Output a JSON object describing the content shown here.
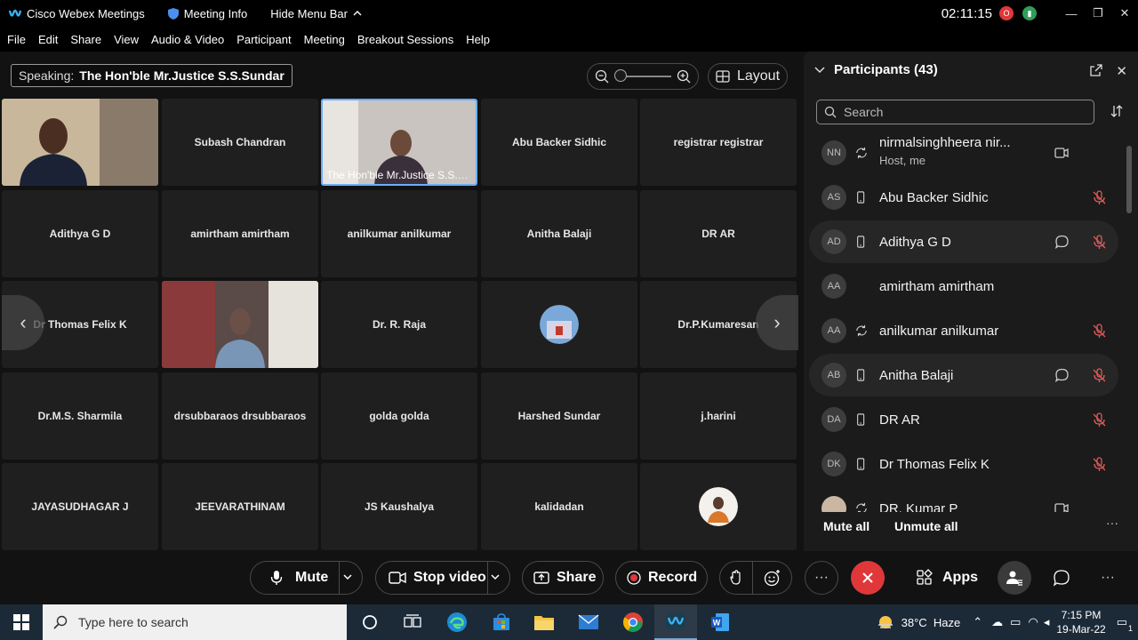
{
  "titlebar": {
    "app_name": "Cisco Webex Meetings",
    "meeting_info": "Meeting Info",
    "hide_menu_bar": "Hide Menu Bar",
    "elapsed_time": "02:11:15",
    "user_badge": "O"
  },
  "menu": [
    "File",
    "Edit",
    "Share",
    "View",
    "Audio & Video",
    "Participant",
    "Meeting",
    "Breakout Sessions",
    "Help"
  ],
  "speaking": {
    "label": "Speaking:",
    "name": "The Hon'ble Mr.Justice S.S.Sundar"
  },
  "layout_button": "Layout",
  "video_grid": {
    "tiles": [
      {
        "name": "",
        "video": true
      },
      {
        "name": "Subash Chandran"
      },
      {
        "name": "The Hon'ble Mr.Justice S.S.Sundar",
        "video": true,
        "active": true
      },
      {
        "name": "Abu Backer Sidhic"
      },
      {
        "name": "registrar registrar"
      },
      {
        "name": "Adithya G D"
      },
      {
        "name": "amirtham amirtham"
      },
      {
        "name": "anilkumar anilkumar"
      },
      {
        "name": "Anitha Balaji"
      },
      {
        "name": "DR AR"
      },
      {
        "name": "Dr Thomas Felix K"
      },
      {
        "name": "",
        "video": true
      },
      {
        "name": "Dr. R. Raja"
      },
      {
        "name": "",
        "avatar": true
      },
      {
        "name": "Dr.P.Kumaresan"
      },
      {
        "name": "Dr.M.S. Sharmila"
      },
      {
        "name": "drsubbaraos drsubbaraos"
      },
      {
        "name": "golda golda"
      },
      {
        "name": "Harshed Sundar"
      },
      {
        "name": "j.harini"
      },
      {
        "name": "JAYASUDHAGAR J"
      },
      {
        "name": "JEEVARATHINAM"
      },
      {
        "name": "JS Kaushalya"
      },
      {
        "name": "kalidadan"
      },
      {
        "name": "",
        "avatar": true
      }
    ]
  },
  "participants_panel": {
    "title": "Participants (43)",
    "search_placeholder": "Search",
    "mute_all": "Mute all",
    "unmute_all": "Unmute all",
    "rows": [
      {
        "initials": "NN",
        "name": "nirmalsinghheera nir...",
        "sub": "Host, me",
        "device": "sync",
        "right": "video"
      },
      {
        "initials": "AS",
        "name": "Abu Backer Sidhic",
        "device": "phone",
        "right": "mic-muted"
      },
      {
        "initials": "AD",
        "name": "Adithya G D",
        "device": "phone",
        "chat": true,
        "right": "mic-muted",
        "highlight": true
      },
      {
        "initials": "AA",
        "name": "amirtham amirtham",
        "device": "",
        "right": ""
      },
      {
        "initials": "AA",
        "name": "anilkumar anilkumar",
        "device": "sync",
        "right": "mic-muted"
      },
      {
        "initials": "AB",
        "name": "Anitha Balaji",
        "device": "phone",
        "chat": true,
        "right": "mic-muted",
        "highlight": true
      },
      {
        "initials": "DA",
        "name": "DR AR",
        "device": "phone",
        "right": "mic-muted"
      },
      {
        "initials": "DK",
        "name": "Dr Thomas Felix K",
        "device": "phone",
        "right": "mic-muted"
      },
      {
        "initials": "",
        "name": "DR. Kumar P",
        "device": "sync",
        "right": "video",
        "photo": true
      }
    ]
  },
  "controls": {
    "mute": "Mute",
    "stop_video": "Stop video",
    "share": "Share",
    "record": "Record",
    "apps": "Apps"
  },
  "taskbar": {
    "search_placeholder": "Type here to search",
    "weather": "38°C  Haze",
    "time": "7:15 PM",
    "date": "19-Mar-22",
    "notification_count": "1"
  },
  "colors": {
    "accent_blue": "#6aaeff",
    "end_red": "#e0383a",
    "panel_bg": "#1b1b1b",
    "tile_bg": "#1f1f1f"
  }
}
